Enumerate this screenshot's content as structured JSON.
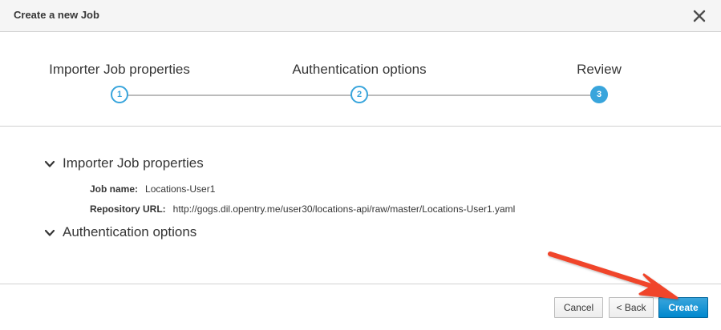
{
  "modal": {
    "title": "Create a new Job",
    "close_icon": "close-icon"
  },
  "wizard": {
    "steps": [
      {
        "label": "Importer Job properties",
        "number": "1",
        "state": "complete"
      },
      {
        "label": "Authentication options",
        "number": "2",
        "state": "complete"
      },
      {
        "label": "Review",
        "number": "3",
        "state": "active"
      }
    ],
    "accent_color": "#39a5dc"
  },
  "review": {
    "sections": [
      {
        "title": "Importer Job properties",
        "expanded": true,
        "fields": [
          {
            "key": "Job name:",
            "value": "Locations-User1"
          },
          {
            "key": "Repository URL:",
            "value": "http://gogs.dil.opentry.me/user30/locations-api/raw/master/Locations-User1.yaml"
          }
        ]
      },
      {
        "title": "Authentication options",
        "expanded": true,
        "fields": []
      }
    ]
  },
  "footer": {
    "cancel_label": "Cancel",
    "back_label": "< Back",
    "create_label": "Create",
    "primary_color": "#0088ce"
  },
  "annotation": {
    "arrow_color": "#f0442c",
    "points_to": "create-button"
  }
}
